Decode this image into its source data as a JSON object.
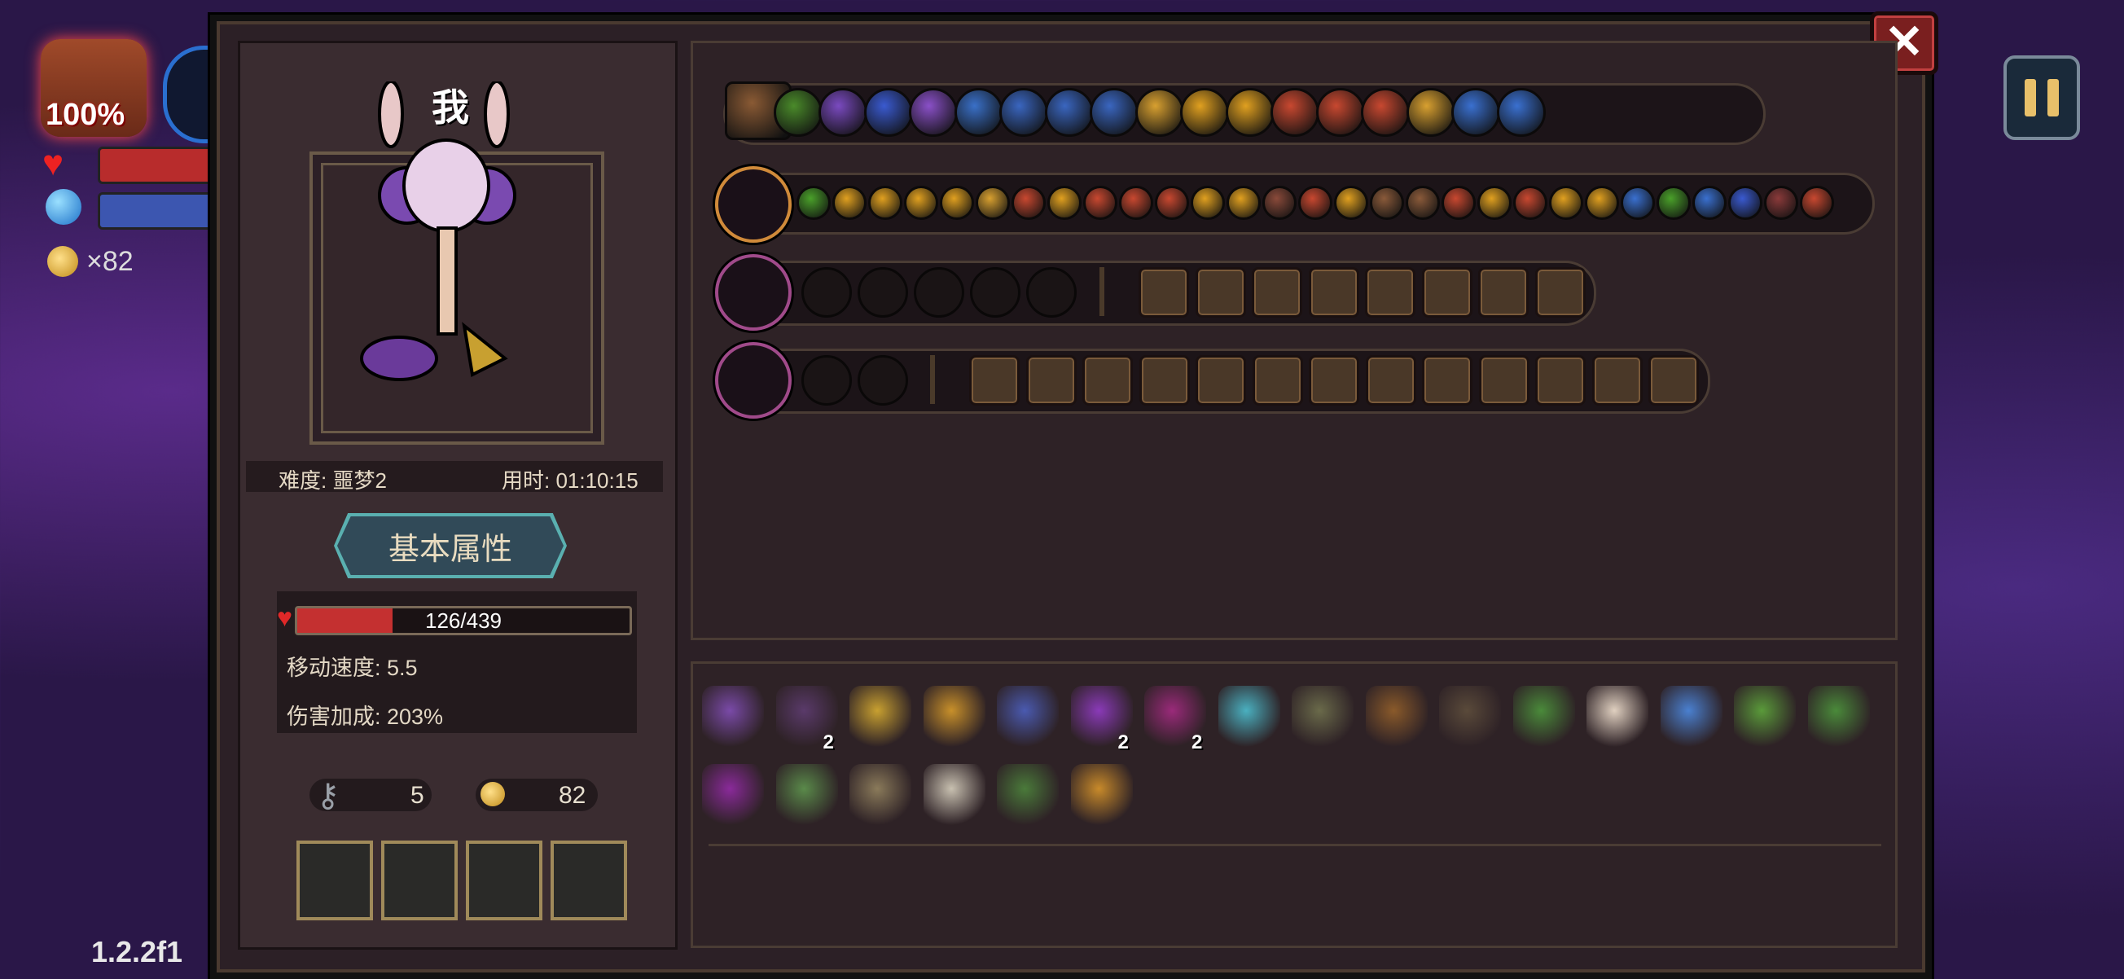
{
  "hud": {
    "health_percent": "100%",
    "coins": "×82",
    "version": "1.2.2f1"
  },
  "character": {
    "name": "我",
    "difficulty": "难度: 噩梦2",
    "play_time": "用时: 01:10:15",
    "attributes_button": "基本属性",
    "hp_text": "126/439",
    "hp_current": 126,
    "hp_max": 439,
    "move_speed": "移动速度: 5.5",
    "damage_bonus": "伤害加成: 203%",
    "keys": "5",
    "gold": "82"
  },
  "close_label": "✕",
  "row1_icons": [
    "satchel-icon",
    "green-flame-icon",
    "purple-orb-icon",
    "spiral-plus-icon",
    "crystal-plus-icon",
    "blue-bottle-icon",
    "crossed-swords-icon",
    "crossed-swords-plus-icon",
    "book-icon",
    "gold-rune-icon",
    "sun-icon",
    "arc-arrow-icon",
    "hourglass-icon",
    "red-gem-plus-icon",
    "red-gem-plus-icon",
    "gold-card-icon",
    "blue-slash-icon",
    "blue-spark-icon"
  ],
  "row1_colors": [
    "#8a5a34",
    "#4a8a2a",
    "#7a4ac0",
    "#3a5ad0",
    "#8a50c8",
    "#3a70c8",
    "#3a66c0",
    "#3a66c0",
    "#3a66c0",
    "#d8a030",
    "#e0a020",
    "#e0a020",
    "#c84830",
    "#c84830",
    "#c84830",
    "#d8a030",
    "#3a70d0",
    "#3a70d0"
  ],
  "row2_icon_colors": [
    "#4aa02a",
    "#e0a020",
    "#e0a020",
    "#e0a020",
    "#e0a020",
    "#d8a030",
    "#c84830",
    "#e0a020",
    "#c84830",
    "#c84830",
    "#c84830",
    "#e0a020",
    "#e0a020",
    "#8a4a3a",
    "#c84830",
    "#e0a020",
    "#8a5a3a",
    "#8a5a3a",
    "#c84830",
    "#e0a020",
    "#c84830",
    "#e0a020",
    "#e0a020",
    "#3a70d0",
    "#4aa02a",
    "#3a70d0",
    "#3a5ad0",
    "#8a3a3a",
    "#c84830"
  ],
  "row3_empty_count": 5,
  "row3_slot_count": 8,
  "row4_empty_count": 2,
  "row4_slot_count": 13,
  "items_row1": [
    {
      "icon": "witch-portrait-icon",
      "color": "#7a4aa8"
    },
    {
      "icon": "cloak-icon",
      "color": "#5a3a6a",
      "count": "2"
    },
    {
      "icon": "antler-icon",
      "color": "#c8a030"
    },
    {
      "icon": "golden-cup-icon",
      "color": "#c8902a"
    },
    {
      "icon": "potion-flask-icon",
      "color": "#4a5ab0"
    },
    {
      "icon": "demon-mask-icon",
      "color": "#8a3ab8",
      "count": "2"
    },
    {
      "icon": "eye-orb-icon",
      "color": "#9a2a7a",
      "count": "2"
    },
    {
      "icon": "striped-pipe-icon",
      "color": "#4ab0c0"
    },
    {
      "icon": "worm-icon",
      "color": "#6a6a4a"
    },
    {
      "icon": "treasure-chest-icon",
      "color": "#8a5a2a"
    },
    {
      "icon": "hood-icon",
      "color": "#5a4a3a"
    },
    {
      "icon": "leaf-icon",
      "color": "#4a8a3a"
    },
    {
      "icon": "feather-icon",
      "color": "#e0d0c0"
    },
    {
      "icon": "blue-gem-icon",
      "color": "#4a80d0"
    },
    {
      "icon": "herb-icon",
      "color": "#5a9a3a"
    },
    {
      "icon": "green-helmet-icon",
      "color": "#4a8a3a"
    }
  ],
  "items_row2": [
    {
      "icon": "purple-eye-icon",
      "color": "#8a2a9a"
    },
    {
      "icon": "green-boot-icon",
      "color": "#5a8a4a"
    },
    {
      "icon": "bone-chain-icon",
      "color": "#8a7a5a"
    },
    {
      "icon": "fang-jaw-icon",
      "color": "#c8c0b0"
    },
    {
      "icon": "green-belt-icon",
      "color": "#4a7a3a"
    },
    {
      "icon": "pickaxe-icon",
      "color": "#c88a2a"
    }
  ]
}
